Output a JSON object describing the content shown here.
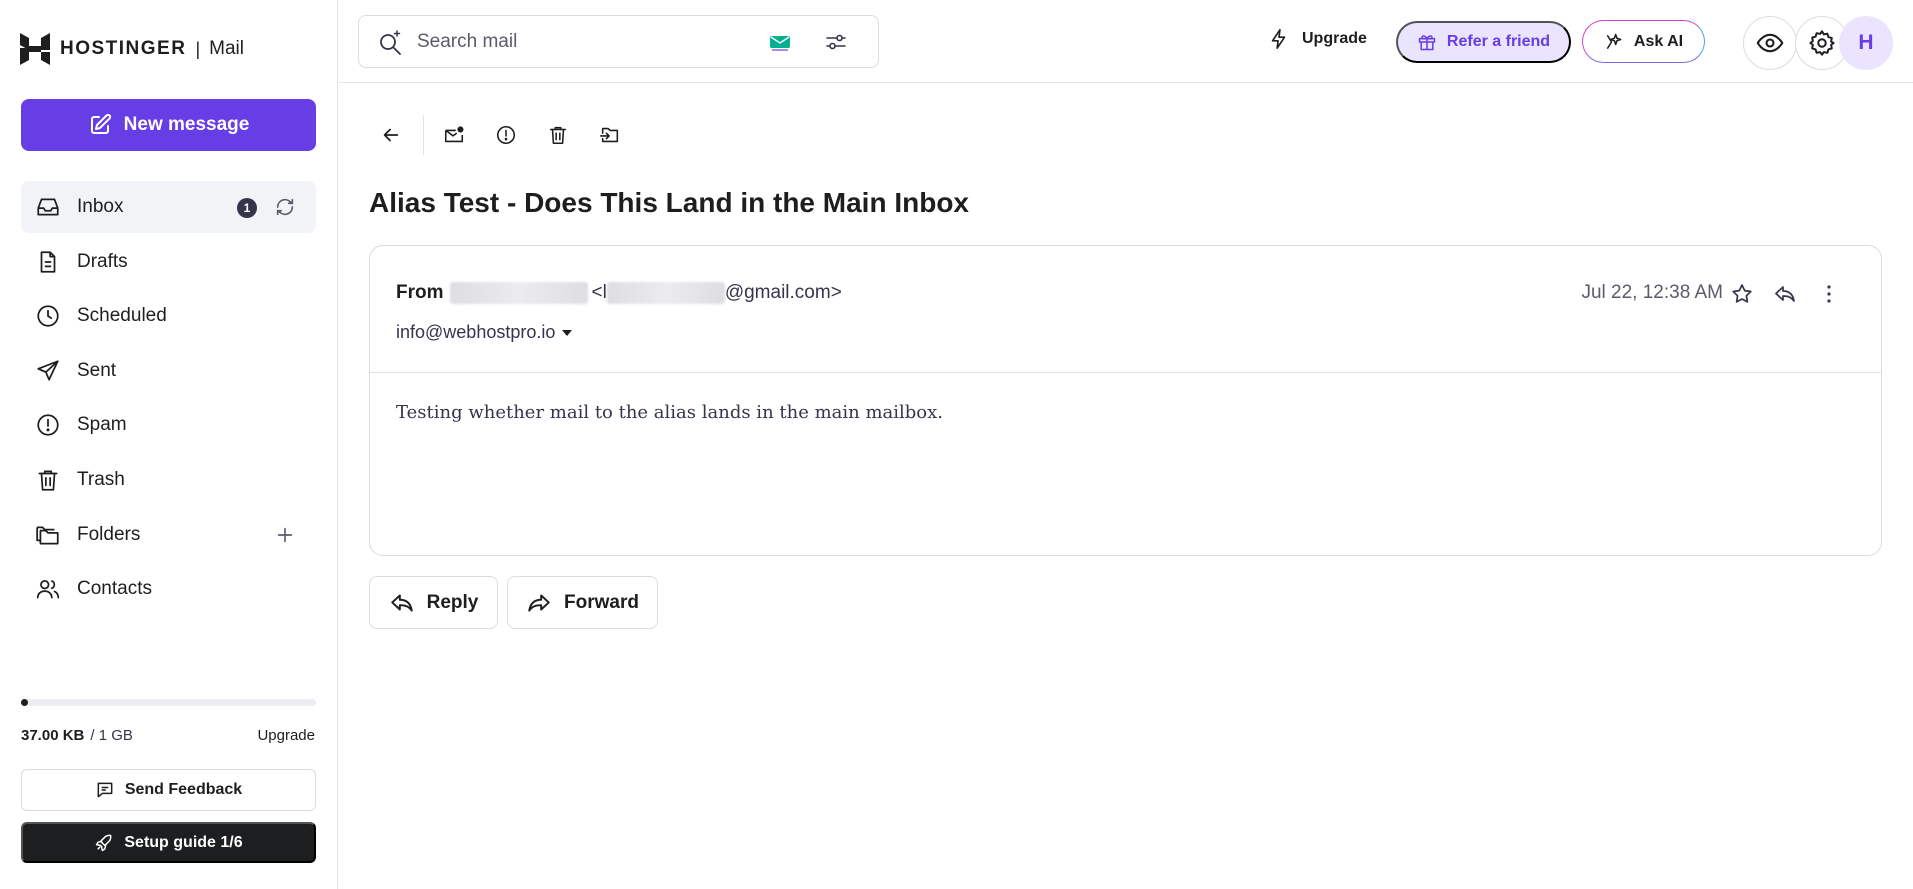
{
  "brand": {
    "name": "HOSTINGER",
    "separator": "|",
    "app": "Mail"
  },
  "sidebar": {
    "new_message": "New message",
    "items": [
      {
        "label": "Inbox",
        "icon": "inbox-icon",
        "badge": "1",
        "active": true
      },
      {
        "label": "Drafts",
        "icon": "drafts-icon"
      },
      {
        "label": "Scheduled",
        "icon": "clock-icon"
      },
      {
        "label": "Sent",
        "icon": "send-icon"
      },
      {
        "label": "Spam",
        "icon": "spam-icon"
      },
      {
        "label": "Trash",
        "icon": "trash-icon"
      },
      {
        "label": "Folders",
        "icon": "folders-icon"
      },
      {
        "label": "Contacts",
        "icon": "contacts-icon"
      }
    ],
    "storage": {
      "used": "37.00 KB",
      "total": "/ 1 GB",
      "upgrade": "Upgrade",
      "fraction": 4e-05
    },
    "feedback": "Send Feedback",
    "setup": "Setup guide 1/6"
  },
  "topbar": {
    "search_placeholder": "Search mail",
    "upgrade": "Upgrade",
    "refer": "Refer a friend",
    "ask_ai": "Ask AI",
    "avatar": "H"
  },
  "message": {
    "subject": "Alias Test - Does This Land in the Main Inbox",
    "from_label": "From",
    "from_open": "<l",
    "from_domain": "@gmail.com>",
    "to": "info@webhostpro.io",
    "date": "Jul 22, 12:38 AM",
    "body": "Testing whether mail to the alias lands in the main mailbox."
  },
  "actions": {
    "reply": "Reply",
    "forward": "Forward"
  },
  "colors": {
    "accent": "#673de6",
    "accent_light": "#ebe4ff",
    "dark": "#1d1e20"
  }
}
